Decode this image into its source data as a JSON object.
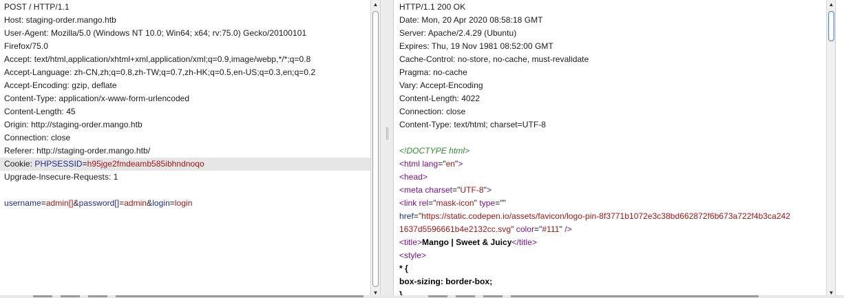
{
  "request": {
    "lines": [
      {
        "parts": [
          {
            "t": "POST / HTTP/1.1",
            "c": "c-plain"
          }
        ]
      },
      {
        "parts": [
          {
            "t": "Host: staging-order.mango.htb",
            "c": "c-plain"
          }
        ]
      },
      {
        "parts": [
          {
            "t": "User-Agent: Mozilla/5.0 (Windows NT 10.0; Win64; x64; rv:75.0) Gecko/20100101",
            "c": "c-plain"
          }
        ]
      },
      {
        "parts": [
          {
            "t": "Firefox/75.0",
            "c": "c-plain"
          }
        ]
      },
      {
        "parts": [
          {
            "t": "Accept: text/html,application/xhtml+xml,application/xml;q=0.9,image/webp,*/*;q=0.8",
            "c": "c-plain"
          }
        ]
      },
      {
        "parts": [
          {
            "t": "Accept-Language: zh-CN,zh;q=0.8,zh-TW;q=0.7,zh-HK;q=0.5,en-US;q=0.3,en;q=0.2",
            "c": "c-plain"
          }
        ]
      },
      {
        "parts": [
          {
            "t": "Accept-Encoding: gzip, deflate",
            "c": "c-plain"
          }
        ]
      },
      {
        "parts": [
          {
            "t": "Content-Type: application/x-www-form-urlencoded",
            "c": "c-plain"
          }
        ]
      },
      {
        "parts": [
          {
            "t": "Content-Length: 45",
            "c": "c-plain"
          }
        ]
      },
      {
        "parts": [
          {
            "t": "Origin: http://staging-order.mango.htb",
            "c": "c-plain"
          }
        ]
      },
      {
        "parts": [
          {
            "t": "Connection: close",
            "c": "c-plain"
          }
        ]
      },
      {
        "parts": [
          {
            "t": "Referer: http://staging-order.mango.htb/",
            "c": "c-plain"
          }
        ]
      },
      {
        "highlight": true,
        "parts": [
          {
            "t": "Cookie: ",
            "c": "c-plain"
          },
          {
            "t": "PHPSESSID",
            "c": "c-name"
          },
          {
            "t": "=",
            "c": "c-plain"
          },
          {
            "t": "h95jge2fmdeamb585ibhndnoqo",
            "c": "c-value"
          }
        ]
      },
      {
        "parts": [
          {
            "t": "Upgrade-Insecure-Requests: 1",
            "c": "c-plain"
          }
        ]
      },
      {
        "blank": true,
        "parts": []
      },
      {
        "parts": [
          {
            "t": "username",
            "c": "c-name"
          },
          {
            "t": "=",
            "c": "c-plain"
          },
          {
            "t": "admin[]",
            "c": "c-value"
          },
          {
            "t": "&",
            "c": "c-plain"
          },
          {
            "t": "password[]",
            "c": "c-name"
          },
          {
            "t": "=",
            "c": "c-plain"
          },
          {
            "t": "admin",
            "c": "c-value"
          },
          {
            "t": "&",
            "c": "c-plain"
          },
          {
            "t": "login",
            "c": "c-name"
          },
          {
            "t": "=",
            "c": "c-plain"
          },
          {
            "t": "login",
            "c": "c-value"
          }
        ]
      }
    ]
  },
  "response": {
    "lines": [
      {
        "parts": [
          {
            "t": "HTTP/1.1 200 OK",
            "c": "c-plain"
          }
        ]
      },
      {
        "parts": [
          {
            "t": "Date: Mon, 20 Apr 2020 08:58:18 GMT",
            "c": "c-plain"
          }
        ]
      },
      {
        "parts": [
          {
            "t": "Server: Apache/2.4.29 (Ubuntu)",
            "c": "c-plain"
          }
        ]
      },
      {
        "parts": [
          {
            "t": "Expires: Thu, 19 Nov 1981 08:52:00 GMT",
            "c": "c-plain"
          }
        ]
      },
      {
        "parts": [
          {
            "t": "Cache-Control: no-store, no-cache, must-revalidate",
            "c": "c-plain"
          }
        ]
      },
      {
        "parts": [
          {
            "t": "Pragma: no-cache",
            "c": "c-plain"
          }
        ]
      },
      {
        "parts": [
          {
            "t": "Vary: Accept-Encoding",
            "c": "c-plain"
          }
        ]
      },
      {
        "parts": [
          {
            "t": "Content-Length: 4022",
            "c": "c-plain"
          }
        ]
      },
      {
        "parts": [
          {
            "t": "Connection: close",
            "c": "c-plain"
          }
        ]
      },
      {
        "parts": [
          {
            "t": "Content-Type: text/html; charset=UTF-8",
            "c": "c-plain"
          }
        ]
      },
      {
        "blank": true,
        "parts": []
      },
      {
        "parts": [
          {
            "t": "<!DOCTYPE html>",
            "c": "c-doctype"
          }
        ]
      },
      {
        "parts": [
          {
            "t": "<html ",
            "c": "c-tag"
          },
          {
            "t": "lang",
            "c": "c-attr"
          },
          {
            "t": "=\"",
            "c": "c-plain"
          },
          {
            "t": "en",
            "c": "c-attrval"
          },
          {
            "t": "\"",
            "c": "c-plain"
          },
          {
            "t": ">",
            "c": "c-tag"
          }
        ]
      },
      {
        "parts": [
          {
            "t": "<head>",
            "c": "c-tag"
          }
        ]
      },
      {
        "parts": [
          {
            "t": "<meta ",
            "c": "c-tag"
          },
          {
            "t": "charset",
            "c": "c-attr"
          },
          {
            "t": "=\"",
            "c": "c-plain"
          },
          {
            "t": "UTF-8",
            "c": "c-attrval"
          },
          {
            "t": "\"",
            "c": "c-plain"
          },
          {
            "t": ">",
            "c": "c-tag"
          }
        ]
      },
      {
        "parts": [
          {
            "t": "<link ",
            "c": "c-tag"
          },
          {
            "t": "rel",
            "c": "c-attr"
          },
          {
            "t": "=\"",
            "c": "c-plain"
          },
          {
            "t": "mask-icon",
            "c": "c-attrval"
          },
          {
            "t": "\" ",
            "c": "c-plain"
          },
          {
            "t": "type",
            "c": "c-attr"
          },
          {
            "t": "=\"\"",
            "c": "c-plain"
          }
        ]
      },
      {
        "parts": [
          {
            "t": "href",
            "c": "c-name"
          },
          {
            "t": "=\"",
            "c": "c-plain"
          },
          {
            "t": "https://static.codepen.io/assets/favicon/logo-pin-8f3771b1072e3c38bd662872f6b673a722f4b3ca242",
            "c": "c-attrval"
          }
        ]
      },
      {
        "parts": [
          {
            "t": "1637d5596661b4e2132cc.svg",
            "c": "c-attrval"
          },
          {
            "t": "\" ",
            "c": "c-plain"
          },
          {
            "t": "color",
            "c": "c-attr"
          },
          {
            "t": "=\"",
            "c": "c-plain"
          },
          {
            "t": "#111",
            "c": "c-attrval"
          },
          {
            "t": "\" ",
            "c": "c-plain"
          },
          {
            "t": "/>",
            "c": "c-tag"
          }
        ]
      },
      {
        "parts": [
          {
            "t": "<title>",
            "c": "c-tag"
          },
          {
            "t": "Mango | Sweet & Juicy",
            "c": "c-css"
          },
          {
            "t": "</title>",
            "c": "c-tag"
          }
        ]
      },
      {
        "parts": [
          {
            "t": "<style>",
            "c": "c-tag"
          }
        ]
      },
      {
        "parts": [
          {
            "t": "* {",
            "c": "c-css"
          }
        ]
      },
      {
        "parts": [
          {
            "t": "  box-sizing: border-box;",
            "c": "c-css"
          }
        ]
      },
      {
        "parts": [
          {
            "t": "}",
            "c": "c-css"
          }
        ]
      }
    ]
  },
  "colors": {
    "name": "#1e2a8f",
    "value": "#a31515",
    "tag": "#7a0f8a",
    "doctype": "#2e8b2e",
    "highlight": "#e6e6e6"
  },
  "icons": {
    "scroll_up": "arrow-up-icon",
    "scroll_down": "arrow-down-icon"
  }
}
